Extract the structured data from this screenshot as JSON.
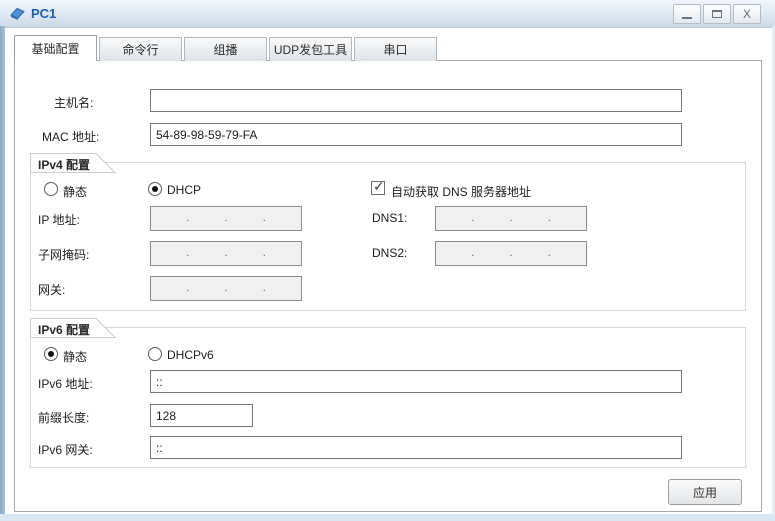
{
  "window": {
    "title": "PC1"
  },
  "titlebar": {
    "close_glyph": "X"
  },
  "tabs": [
    {
      "label": "基础配置"
    },
    {
      "label": "命令行"
    },
    {
      "label": "组播"
    },
    {
      "label": "UDP发包工具"
    },
    {
      "label": "串口"
    }
  ],
  "basic": {
    "hostname_label": "主机名:",
    "hostname_value": "",
    "mac_label": "MAC 地址:",
    "mac_value": "54-89-98-59-79-FA"
  },
  "ipv4": {
    "group_label": "IPv4 配置",
    "static_label": "静态",
    "dhcp_label": "DHCP",
    "dns_auto_label": "自动获取 DNS 服务器地址",
    "check_glyph": "✓",
    "ip_label": "IP 地址:",
    "mask_label": "子网掩码:",
    "gateway_label": "网关:",
    "dns1_label": "DNS1:",
    "dns2_label": "DNS2:",
    "dot": "."
  },
  "ipv6": {
    "group_label": "IPv6 配置",
    "static_label": "静态",
    "dhcpv6_label": "DHCPv6",
    "addr_label": "IPv6 地址:",
    "addr_value": "::",
    "prefix_label": "前缀长度:",
    "prefix_value": "128",
    "gateway_label": "IPv6 网关:",
    "gateway_value": "::"
  },
  "footer": {
    "apply_label": "应用"
  }
}
